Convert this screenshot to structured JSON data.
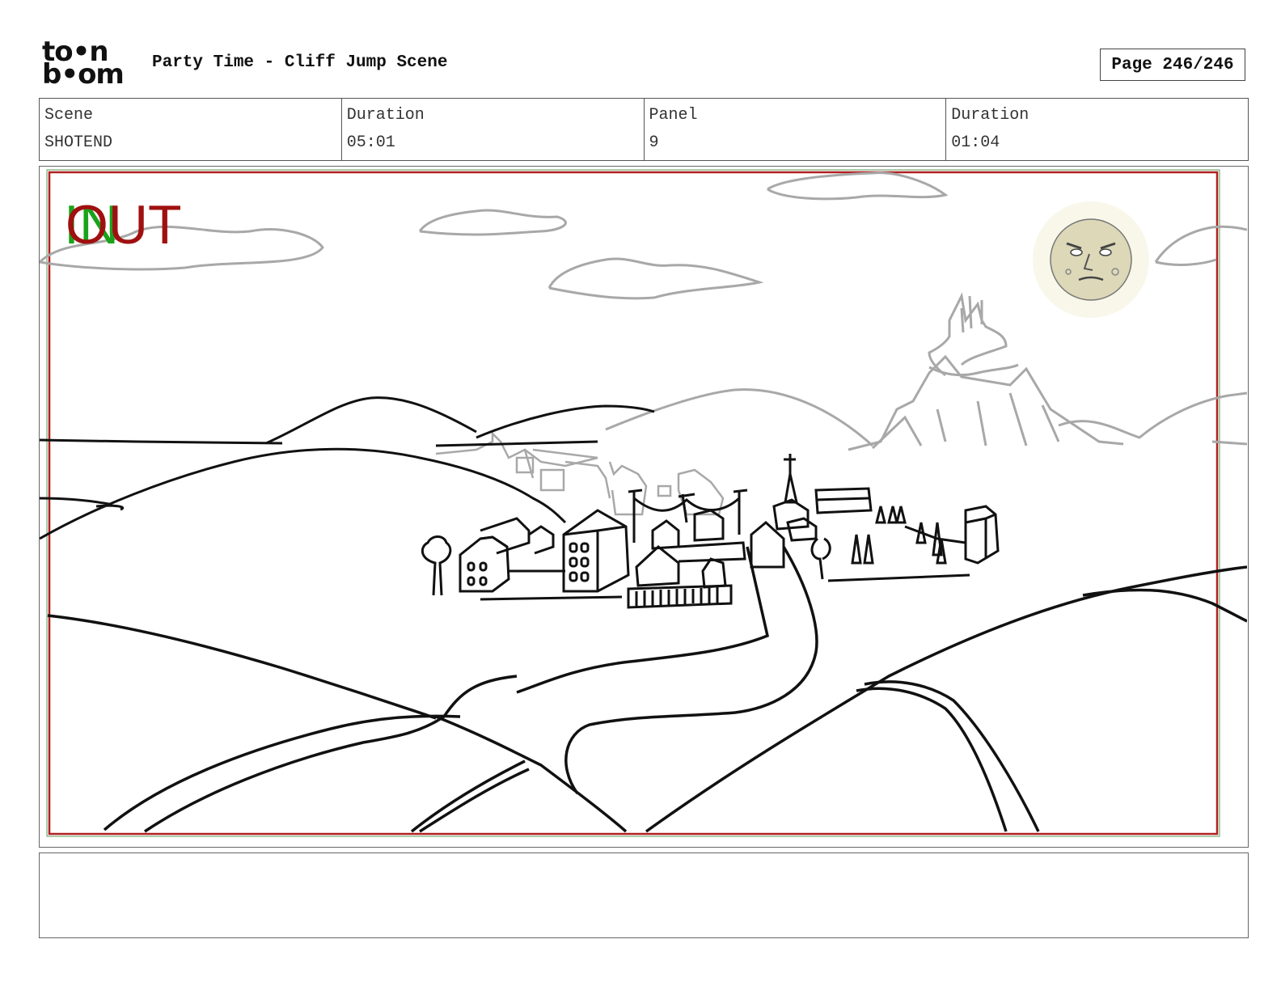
{
  "logo": {
    "line1": "to•n",
    "line2": "b•om",
    "text": "toon boom"
  },
  "header": {
    "title": "Party Time - Cliff Jump Scene",
    "page": "Page 246/246"
  },
  "info": {
    "scene_label": "Scene",
    "scene_value": "SHOTEND",
    "scene_duration_label": "Duration",
    "scene_duration_value": "05:01",
    "panel_label": "Panel",
    "panel_value": "9",
    "panel_duration_label": "Duration",
    "panel_duration_value": "01:04"
  },
  "panel": {
    "in_marker": "IN",
    "out_marker": "OUT",
    "colors": {
      "in": "#1aa31a",
      "out": "#a01010",
      "sketch": "#111111",
      "background_sketch": "#a8a8a8",
      "safe_frame": "#b02020"
    }
  },
  "notes": {
    "text": ""
  }
}
